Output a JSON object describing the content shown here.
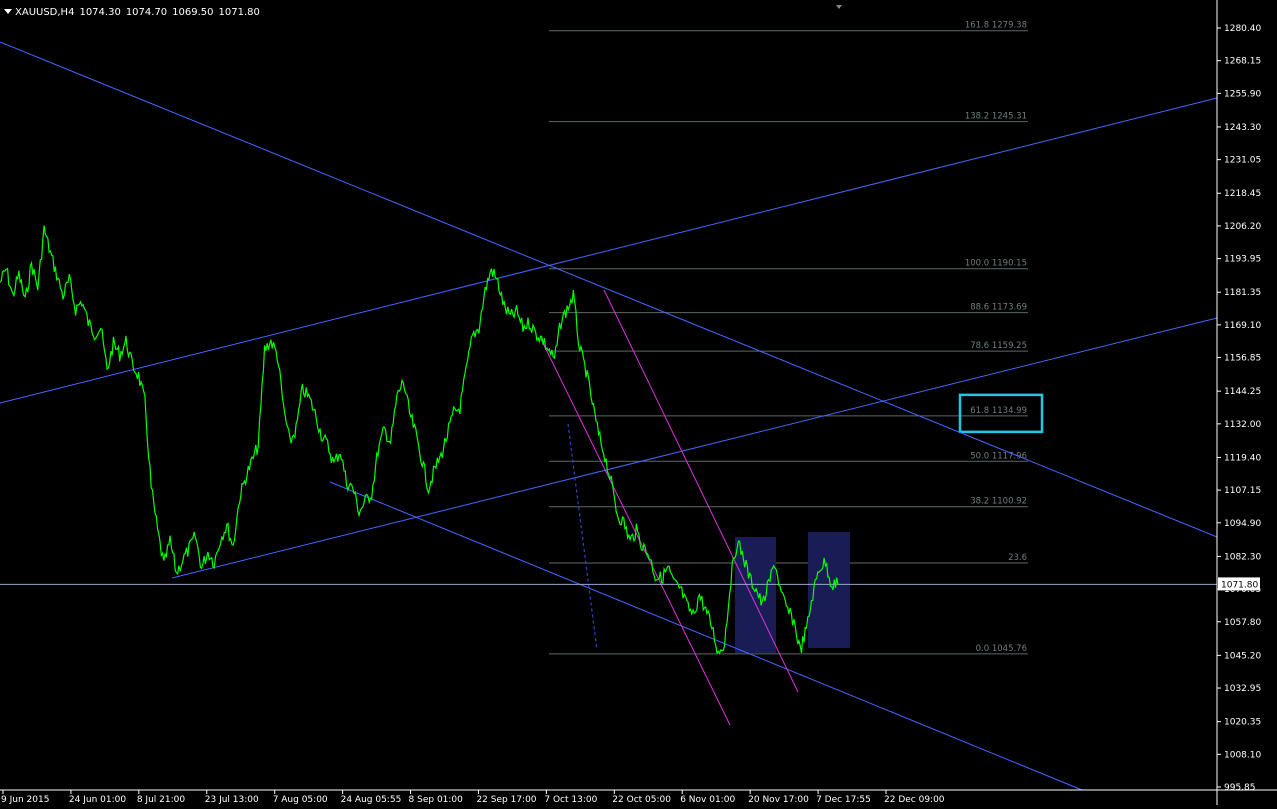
{
  "header": {
    "symbol": "XAUUSD,H4",
    "open": "1074.30",
    "high": "1074.70",
    "low": "1069.50",
    "close": "1071.80"
  },
  "colors": {
    "background": "#000000",
    "price_line": "#00ff00",
    "trend_lines": "#4466ff",
    "magenta_channel": "#dd33dd",
    "fib_levels": "#5a6a6a",
    "highlight_box": "#1ec8e6",
    "range_box": "#1a1d55",
    "axis": "#ffffff"
  },
  "chart_data": {
    "type": "line",
    "title": "",
    "xlabel": "",
    "ylabel": "",
    "ylim": [
      995.85,
      1285.0
    ],
    "y_ticks": [
      "1280.40",
      "1268.15",
      "1255.90",
      "1243.30",
      "1231.05",
      "1218.45",
      "1206.20",
      "1193.95",
      "1181.35",
      "1169.10",
      "1156.85",
      "1144.25",
      "1132.00",
      "1119.40",
      "1107.15",
      "1094.90",
      "1082.30",
      "1070.05",
      "1057.80",
      "1045.20",
      "1032.95",
      "1020.35",
      "1008.10",
      "995.85"
    ],
    "x_ticks": [
      "9 Jun 2015",
      "24 Jun 01:00",
      "8 Jul 21:00",
      "23 Jul 13:00",
      "7 Aug 05:00",
      "24 Aug 05:55",
      "8 Sep 01:00",
      "22 Sep 17:00",
      "7 Oct 13:00",
      "22 Oct 05:00",
      "6 Nov 01:00",
      "20 Nov 17:00",
      "7 Dec 17:55",
      "22 Dec 09:00"
    ],
    "current_price": "1071.80",
    "series": [
      {
        "values": [
          1185,
          1190,
          1180,
          1188,
          1178,
          1192,
          1183,
          1205,
          1196,
          1188,
          1180,
          1186,
          1175,
          1178,
          1170,
          1166,
          1168,
          1152,
          1162,
          1158,
          1163,
          1154,
          1150,
          1140,
          1108,
          1092,
          1079,
          1088,
          1076,
          1081,
          1085,
          1090,
          1078,
          1084,
          1080,
          1089,
          1094,
          1086,
          1104,
          1112,
          1118,
          1124,
          1160,
          1163,
          1158,
          1138,
          1125,
          1130,
          1145,
          1142,
          1136,
          1128,
          1124,
          1117,
          1122,
          1110,
          1108,
          1099,
          1103,
          1106,
          1122,
          1130,
          1125,
          1142,
          1148,
          1136,
          1128,
          1118,
          1108,
          1115,
          1120,
          1128,
          1136,
          1138,
          1152,
          1165,
          1168,
          1182,
          1190,
          1185,
          1176,
          1172,
          1174,
          1168,
          1170,
          1166,
          1164,
          1160,
          1156,
          1170,
          1175,
          1180,
          1160,
          1152,
          1140,
          1128,
          1120,
          1110,
          1098,
          1095,
          1088,
          1092,
          1086,
          1083,
          1075,
          1074,
          1078,
          1072,
          1070,
          1064,
          1060,
          1068,
          1062,
          1056,
          1046,
          1050,
          1074,
          1088,
          1082,
          1074,
          1070,
          1064,
          1072,
          1080,
          1068,
          1062,
          1058,
          1047,
          1055,
          1068,
          1078,
          1080,
          1072,
          1071.8
        ],
        "x_range": [
          "9 Jun 2015",
          "22 Dec 09:00"
        ]
      }
    ],
    "fibonacci": [
      {
        "label": "161.8 1279.38",
        "value": 1279.38
      },
      {
        "label": "138.2 1245.31",
        "value": 1245.31
      },
      {
        "label": "100.0 1190.15",
        "value": 1190.15
      },
      {
        "label": "88.6 1173.69",
        "value": 1173.69
      },
      {
        "label": "78.6 1159.25",
        "value": 1159.25
      },
      {
        "label": "61.8 1134.99",
        "value": 1134.99
      },
      {
        "label": "50.0 1117.96",
        "value": 1117.96
      },
      {
        "label": "38.2 1100.92",
        "value": 1100.92
      },
      {
        "label": "23.6",
        "value": 1079.85
      },
      {
        "label": "0.0 1045.76",
        "value": 1045.76
      }
    ],
    "grid": false
  }
}
